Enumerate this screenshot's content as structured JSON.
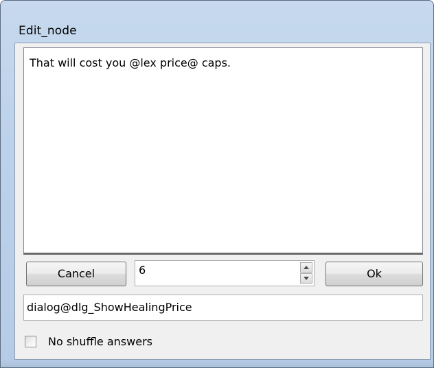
{
  "window": {
    "title": "Edit_node"
  },
  "editor": {
    "text": "That will cost you @lex price@ caps."
  },
  "buttons": {
    "cancel_label": "Cancel",
    "ok_label": "Ok"
  },
  "numeric": {
    "value": "6",
    "up_icon": "arrow-up-icon",
    "down_icon": "arrow-down-icon"
  },
  "combo": {
    "selected": "dialog@dlg_ShowHealingPrice",
    "arrow_icon": "chevron-down-icon"
  },
  "options": {
    "no_shuffle_label": "No shuffle answers",
    "no_shuffle_checked": false
  },
  "colors": {
    "frame": "#bcd2ea",
    "client": "#f0f0f0"
  }
}
